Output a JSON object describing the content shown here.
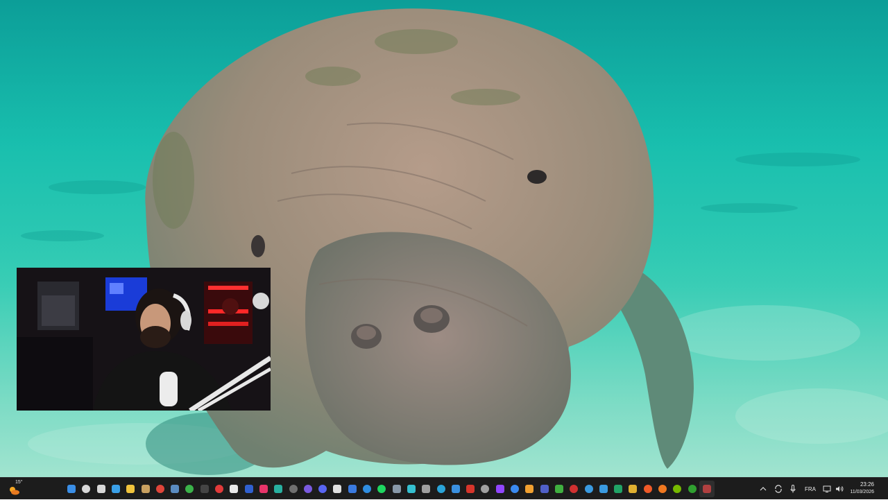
{
  "wallpaper": {
    "subject": "manatee-underwater",
    "colors": {
      "water": "#19bfae",
      "sand": "#88dcc6",
      "manatee": "#9a8f80"
    }
  },
  "webcam_overlay": {
    "visible": true
  },
  "taskbar": {
    "weather": {
      "temperature": "15°",
      "icon": "weather-partly-sunny-icon"
    },
    "apps": [
      {
        "name": "start-button",
        "color": "#3a8ee6",
        "round": false
      },
      {
        "name": "search-button",
        "color": "#d8d8d8",
        "round": true
      },
      {
        "name": "task-view-button",
        "color": "#d8d8d8",
        "round": false
      },
      {
        "name": "widgets-app",
        "color": "#3aa0e8",
        "round": false
      },
      {
        "name": "file-explorer-app",
        "color": "#f0c33c",
        "round": false
      },
      {
        "name": "app-shield",
        "color": "#c8a060",
        "round": false
      },
      {
        "name": "chrome-app",
        "color": "#e0453a",
        "round": true
      },
      {
        "name": "steam-app",
        "color": "#5a8bc0",
        "round": false
      },
      {
        "name": "xbox-app",
        "color": "#3bb34a",
        "round": true
      },
      {
        "name": "terminal-app",
        "color": "#444444",
        "round": false
      },
      {
        "name": "red-app",
        "color": "#e23a3a",
        "round": true
      },
      {
        "name": "epic-app",
        "color": "#e8e8e8",
        "round": false
      },
      {
        "name": "ubisoft-connect-app",
        "color": "#3060d0",
        "round": false
      },
      {
        "name": "tiktok-app",
        "color": "#e8346a",
        "round": false
      },
      {
        "name": "teal-app",
        "color": "#28b0a0",
        "round": false
      },
      {
        "name": "obs-app",
        "color": "#707070",
        "round": true
      },
      {
        "name": "purple-app",
        "color": "#7a5ae0",
        "round": true
      },
      {
        "name": "discord-app",
        "color": "#5865f2",
        "round": true
      },
      {
        "name": "dark-app",
        "color": "#e0e0e0",
        "round": false
      },
      {
        "name": "blue-app",
        "color": "#3a7ae0",
        "round": false
      },
      {
        "name": "edge-app",
        "color": "#2f8de0",
        "round": true
      },
      {
        "name": "spotify-app",
        "color": "#1ed760",
        "round": true
      },
      {
        "name": "app-gray",
        "color": "#8898a8",
        "round": false
      },
      {
        "name": "capcut-app",
        "color": "#35c0d0",
        "round": false
      },
      {
        "name": "pen-app",
        "color": "#a0a0a0",
        "round": false
      },
      {
        "name": "telegram-app",
        "color": "#2aa4d8",
        "round": true
      },
      {
        "name": "photos-app",
        "color": "#3a90e0",
        "round": false
      },
      {
        "name": "adobe-app",
        "color": "#d6352b",
        "round": false
      },
      {
        "name": "gog-app",
        "color": "#a0a0a0",
        "round": true
      },
      {
        "name": "twitch-app",
        "color": "#9146ff",
        "round": false
      },
      {
        "name": "battlenet-app",
        "color": "#3a8af0",
        "round": true
      },
      {
        "name": "store-app",
        "color": "#f0a030",
        "round": false
      },
      {
        "name": "teams-app",
        "color": "#5060c8",
        "round": false
      },
      {
        "name": "green-app",
        "color": "#40b040",
        "round": false
      },
      {
        "name": "record-app",
        "color": "#d03030",
        "round": true
      },
      {
        "name": "settings-app",
        "color": "#3a9ae0",
        "round": true
      },
      {
        "name": "windows-app",
        "color": "#3a9ae0",
        "round": false
      },
      {
        "name": "excel-app",
        "color": "#21a366",
        "round": false
      },
      {
        "name": "folder-app",
        "color": "#e0b030",
        "round": false
      },
      {
        "name": "brave-app",
        "color": "#f05a28",
        "round": true
      },
      {
        "name": "search-orange-app",
        "color": "#f07820",
        "round": true
      },
      {
        "name": "nvidia-app",
        "color": "#76b900",
        "round": true
      },
      {
        "name": "xbox-game-bar-app",
        "color": "#30a030",
        "round": true
      },
      {
        "name": "active-app",
        "color": "#b04040",
        "round": false
      }
    ],
    "tray": {
      "show_hidden_icon": "chevron-up-icon",
      "microphone_icon": "microphone-icon",
      "language": "FRA",
      "network_icon": "network-icon",
      "volume_icon": "volume-icon"
    },
    "clock": {
      "time": "23:26",
      "date": "11/03/2026"
    }
  }
}
